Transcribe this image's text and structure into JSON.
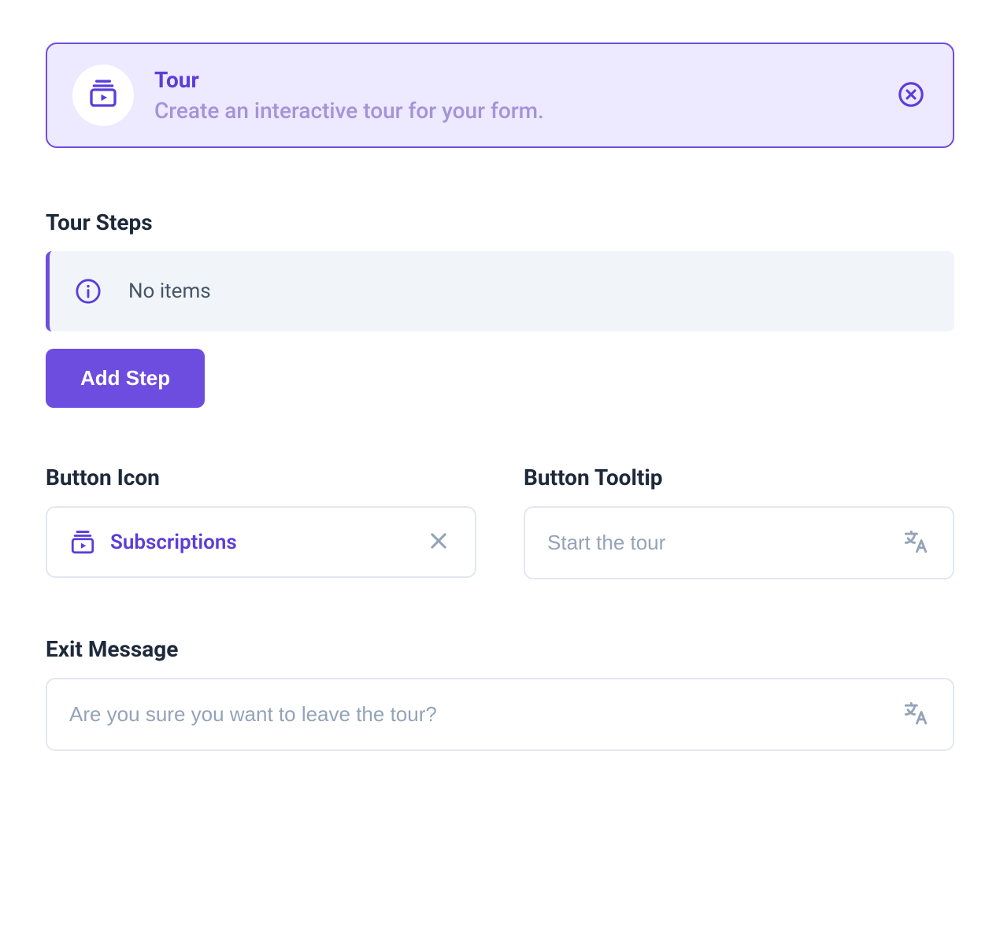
{
  "header": {
    "title": "Tour",
    "subtitle": "Create an interactive tour for your form."
  },
  "steps": {
    "heading": "Tour Steps",
    "empty": "No items",
    "add_label": "Add Step"
  },
  "button_icon": {
    "heading": "Button Icon",
    "value": "Subscriptions"
  },
  "button_tooltip": {
    "heading": "Button Tooltip",
    "placeholder": "Start the tour"
  },
  "exit_message": {
    "heading": "Exit Message",
    "placeholder": "Are you sure you want to leave the tour?"
  }
}
